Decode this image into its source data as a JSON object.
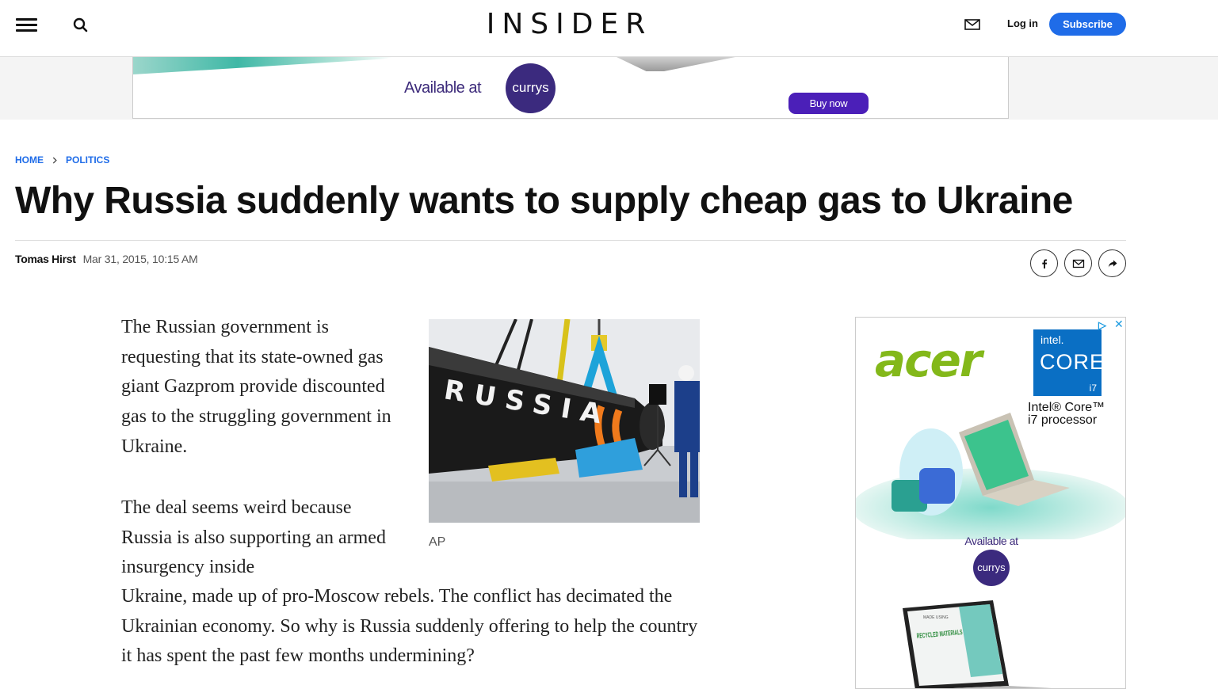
{
  "header": {
    "logo": "INSIDER",
    "login_label": "Log in",
    "subscribe_label": "Subscribe"
  },
  "top_ad": {
    "available_text": "Available at",
    "retailer": "currys",
    "buy_label": "Buy now"
  },
  "breadcrumb": [
    {
      "label": "HOME"
    },
    {
      "label": "POLITICS"
    }
  ],
  "article": {
    "title": "Why Russia suddenly wants to supply cheap gas to Ukraine",
    "author": "Tomas Hirst",
    "date": "Mar 31, 2015, 10:15 AM",
    "paragraph1": "The Russian government is requesting that its state-owned gas giant Gazprom provide discounted gas to the struggling government in Ukraine.",
    "paragraph2_start": "The deal seems weird because Russia is also supporting an armed insurgency inside",
    "paragraph2_end": "Ukraine, made up of pro-Moscow rebels. The conflict has decimated the Ukrainian economy. So why is Russia suddenly offering to help the country it has spent the past few months undermining?",
    "image_text": "RUSSIA",
    "image_caption": "AP"
  },
  "share_buttons": [
    {
      "icon": "facebook-icon"
    },
    {
      "icon": "email-icon"
    },
    {
      "icon": "share-arrow-icon"
    }
  ],
  "side_ad": {
    "brand": "acer",
    "intel_line1": "intel.",
    "intel_line2": "CORE",
    "intel_line3": "i7",
    "processor_line1": "Intel® Core™",
    "processor_line2": "i7 processor",
    "available_text": "Available at",
    "retailer": "currys",
    "screen_text1": "MADE USING",
    "screen_text2": "RECYCLED MATERIALS"
  },
  "colors": {
    "accent_blue": "#1f6ce8",
    "currys_purple": "#3b2a7e",
    "buy_button": "#4b1fb8",
    "acer_green": "#83b81a",
    "intel_blue": "#0a6fc4"
  }
}
